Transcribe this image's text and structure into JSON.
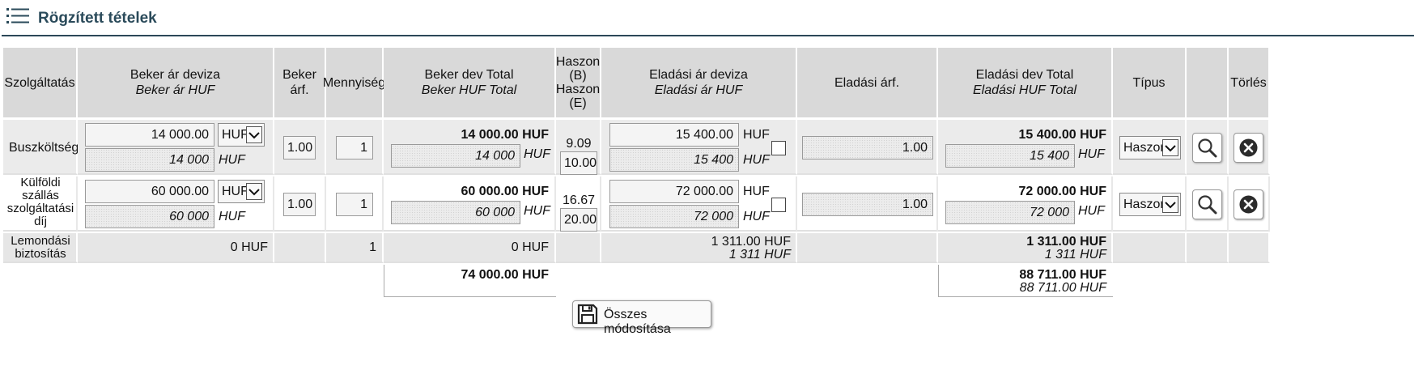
{
  "header": {
    "title": "Rögzített tételek",
    "menu_icon": "list-menu-icon"
  },
  "columns": {
    "szolg": "Szolgáltatás",
    "beker_ar_deviza": "Beker ár deviza",
    "beker_ar_huf": "Beker ár HUF",
    "beker_arf": "Beker árf.",
    "mennyiseg": "Mennyiség",
    "beker_dev_total": "Beker dev Total",
    "beker_huf_total": "Beker HUF Total",
    "haszon_b_1": "Haszon",
    "haszon_b_2": "(B)",
    "haszon_e_1": "Haszon",
    "haszon_e_2": "(E)",
    "eladasi_ar_deviza": "Eladási ár deviza",
    "eladasi_ar_huf": "Eladási ár HUF",
    "eladasi_arf": "Eladási árf.",
    "eladasi_dev_total": "Eladási dev Total",
    "eladasi_huf_total": "Eladási HUF Total",
    "tipus": "Típus",
    "torles": "Törlés"
  },
  "rows": [
    {
      "service": "Buszköltség",
      "beker_deviza_value": "14 000.00",
      "currency_select": "HUF",
      "beker_huf_value": "14 000",
      "beker_huf_unit": "HUF",
      "beker_arf": "1.00",
      "mennyiseg": "1",
      "beker_dev_total": "14 000.00 HUF",
      "beker_huf_total_value": "14 000",
      "beker_huf_total_unit": "HUF",
      "haszon_b": "9.09",
      "haszon_e": "10.00",
      "eladasi_deviza_value": "15 400.00",
      "eladasi_deviza_unit": "HUF",
      "eladasi_huf_value": "15 400",
      "eladasi_huf_unit": "HUF",
      "eladasi_arf": "1.00",
      "eladasi_dev_total": "15 400.00 HUF",
      "eladasi_huf_total_value": "15 400",
      "eladasi_huf_total_unit": "HUF",
      "tipus": "Haszon"
    },
    {
      "service_l1": "Külföldi",
      "service_l2": "szállás",
      "service_l3": "szolgáltatási",
      "service_l4": "díj",
      "beker_deviza_value": "60 000.00",
      "currency_select": "HUF",
      "beker_huf_value": "60 000",
      "beker_huf_unit": "HUF",
      "beker_arf": "1.00",
      "mennyiseg": "1",
      "beker_dev_total": "60 000.00 HUF",
      "beker_huf_total_value": "60 000",
      "beker_huf_total_unit": "HUF",
      "haszon_b": "16.67",
      "haszon_e": "20.00",
      "eladasi_deviza_value": "72 000.00",
      "eladasi_deviza_unit": "HUF",
      "eladasi_huf_value": "72 000",
      "eladasi_huf_unit": "HUF",
      "eladasi_arf": "1.00",
      "eladasi_dev_total": "72 000.00 HUF",
      "eladasi_huf_total_value": "72 000",
      "eladasi_huf_total_unit": "HUF",
      "tipus": "Haszon"
    },
    {
      "service_l1": "Lemondási",
      "service_l2": "biztosítás",
      "beker_ar": "0 HUF",
      "mennyiseg": "1",
      "beker_total": "0 HUF",
      "eladasi_deviza": "1 311.00 HUF",
      "eladasi_huf": "1 311 HUF",
      "eladasi_dev_total": "1 311.00 HUF",
      "eladasi_huf_total": "1 311 HUF"
    }
  ],
  "totals": {
    "beker_total": "74 000.00 HUF",
    "eladasi_dev_total": "88 711.00 HUF",
    "eladasi_huf_total": "88 711.00 HUF"
  },
  "save_button": {
    "label": "Összes módosítása",
    "icon": "floppy-disk-icon"
  },
  "icons": {
    "search": "search-icon",
    "delete": "delete-circle-icon"
  }
}
